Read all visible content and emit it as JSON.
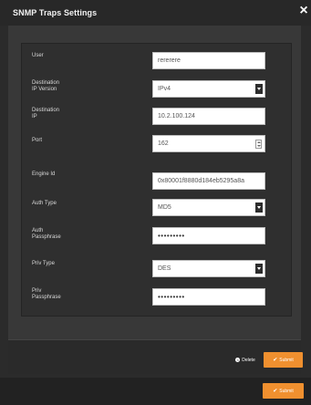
{
  "dialog": {
    "title": "SNMP Traps Settings",
    "close_glyph": "×"
  },
  "form": {
    "user": {
      "label": "User",
      "value": "rererere"
    },
    "dest_ip_version": {
      "label_line1": "Destination",
      "label_line2": "IP Version",
      "value": "IPv4"
    },
    "dest_ip": {
      "label_line1": "Destination",
      "label_line2": "IP",
      "value": "10.2.100.124"
    },
    "port": {
      "label": "Port",
      "value": "162"
    },
    "engine_id": {
      "label": "Engine Id",
      "value": "0x80001f8880d184eb5295a8a"
    },
    "auth_type": {
      "label": "Auth Type",
      "value": "MD5"
    },
    "auth_passphrase": {
      "label_line1": "Auth",
      "label_line2": "Passphrase",
      "value": "•••••••••"
    },
    "priv_type": {
      "label": "Priv Type",
      "value": "DES"
    },
    "priv_passphrase": {
      "label_line1": "Priv",
      "label_line2": "Passphrase",
      "value": "•••••••••"
    }
  },
  "footer": {
    "delete_label": "Delete",
    "submit_label": "Submit",
    "submit_label_2": "Submit",
    "check_glyph": "✔",
    "delete_glyph": "×"
  },
  "colors": {
    "accent": "#f0902f",
    "background": "#2b2b2b"
  }
}
